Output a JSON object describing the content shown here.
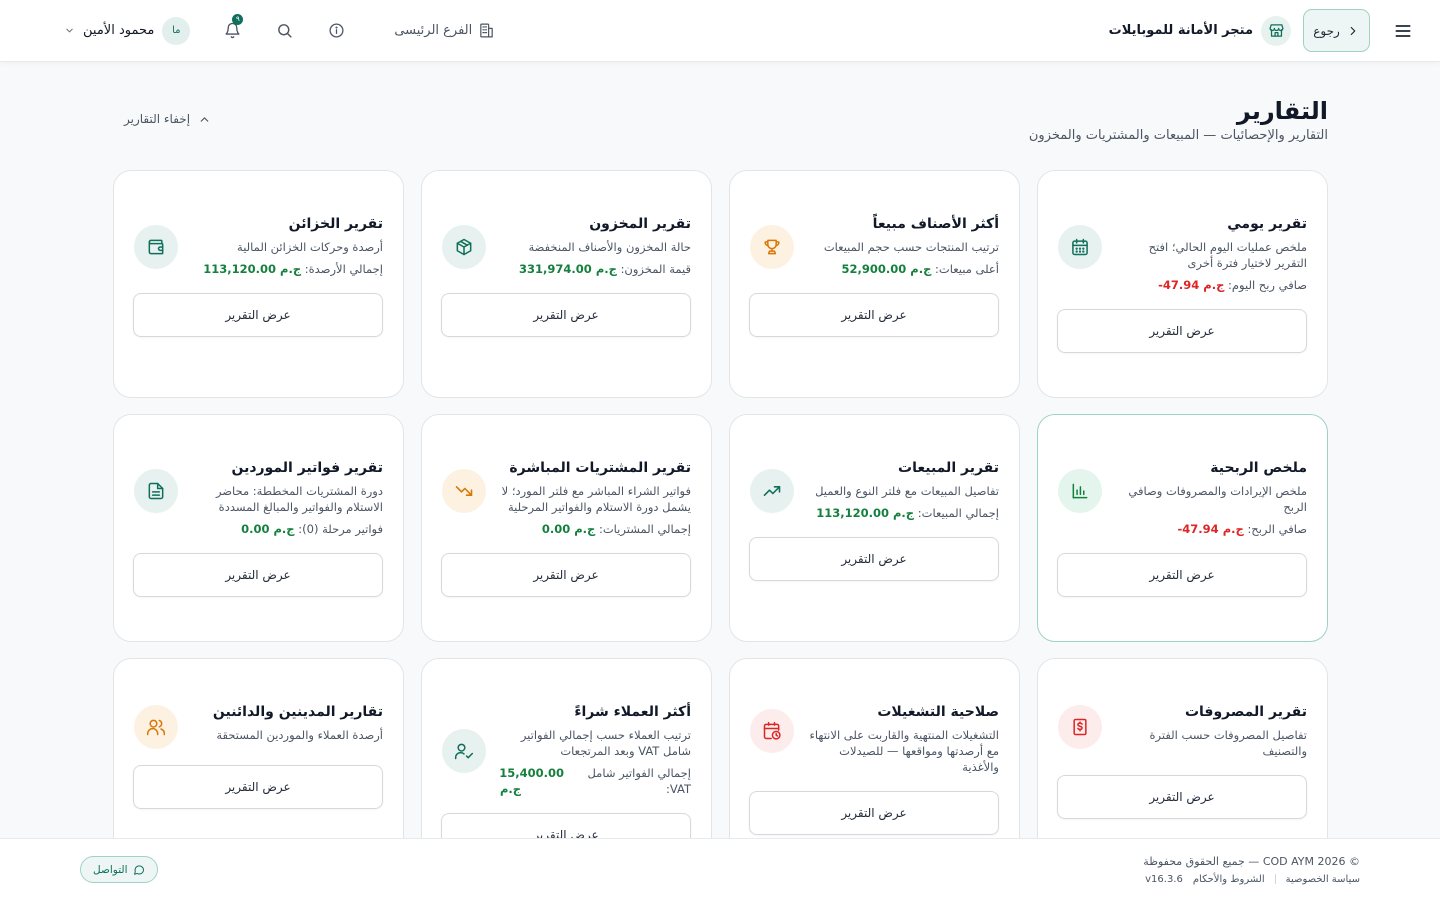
{
  "header": {
    "store_name": "متجر الأمانة للموبايلات",
    "back_label": "رجوع",
    "user_initials": "ما",
    "user_name": "محمود الأمين",
    "notification_count": "٩",
    "branch": "الفرع الرئيسى"
  },
  "page": {
    "title": "التقارير",
    "subtitle": "التقارير والإحصائيات — المبيعات والمشتريات والمخزون",
    "hide_reports": "إخفاء التقارير"
  },
  "view_report_label": "عرض التقرير",
  "cards": [
    {
      "title": "تقرير يومي",
      "desc": "ملخص عمليات اليوم الحالي؛ افتح التقرير لاختيار فترة أخرى",
      "metric_label": "صافي ربح اليوم:",
      "metric_value": "ج.م 47.94-",
      "icon": "calendar-icon"
    },
    {
      "title": "أكثر الأصناف مبيعاً",
      "desc": "ترتيب المنتجات حسب حجم المبيعات",
      "metric_label": "أعلى مبيعات:",
      "metric_value": "ج.م 52,900.00",
      "icon": "trophy-icon"
    },
    {
      "title": "تقرير المخزون",
      "desc": "حالة المخزون والأصناف المنخفضة",
      "metric_label": "قيمة المخزون:",
      "metric_value": "ج.م 331,974.00",
      "icon": "package-icon"
    },
    {
      "title": "تقرير الخزائن",
      "desc": "أرصدة وحركات الخزائن المالية",
      "metric_label": "إجمالي الأرصدة:",
      "metric_value": "ج.م 113,120.00",
      "icon": "wallet-icon"
    },
    {
      "title": "ملخص الربحية",
      "desc": "ملخص الإيرادات والمصروفات وصافي الربح",
      "metric_label": "صافي الربح:",
      "metric_value": "ج.م 47.94-",
      "icon": "bar-chart-icon"
    },
    {
      "title": "تقرير المبيعات",
      "desc": "تفاصيل المبيعات مع فلتر النوع والعميل",
      "metric_label": "إجمالي المبيعات:",
      "metric_value": "ج.م 113,120.00",
      "icon": "trending-up-icon"
    },
    {
      "title": "تقرير المشتريات المباشرة",
      "desc": "فواتير الشراء المباشر مع فلتر المورد؛ لا يشمل دورة الاستلام والفواتير المرحلية",
      "metric_label": "إجمالي المشتريات:",
      "metric_value": "ج.م 0.00",
      "icon": "trending-down-icon"
    },
    {
      "title": "تقرير فواتير الموردين",
      "desc": "دورة المشتريات المخططة: محاضر الاستلام والفواتير والمبالغ المسددة",
      "metric_label": "فواتير مرحلة (0):",
      "metric_value": "ج.م 0.00",
      "icon": "file-text-icon"
    },
    {
      "title": "تقرير المصروفات",
      "desc": "تفاصيل المصروفات حسب الفترة والتصنيف",
      "icon": "receipt-icon"
    },
    {
      "title": "صلاحية التشغيلات",
      "desc": "التشغيلات المنتهية والقاربت على الانتهاء مع أرصدتها ومواقعها — للصيدلات والأغذية",
      "icon": "calendar-clock-icon"
    },
    {
      "title": "أكثر العملاء شراءً",
      "desc": "ترتيب العملاء حسب إجمالي الفواتير شامل VAT وبعد المرتجعات",
      "metric_label": "إجمالي الفواتير شامل VAT:",
      "metric_value": "15,400.00 ج.م",
      "icon": "user-check-icon"
    },
    {
      "title": "تقارير المدينين والدائنين",
      "desc": "أرصدة العملاء والموردين المستحقة",
      "icon": "users-icon"
    }
  ],
  "footer": {
    "copyright": "© COD AYM 2026 — جميع الحقوق محفوظة",
    "privacy": "سياسة الخصوصية",
    "terms": "الشروط والأحكام",
    "version": "v16.3.6",
    "contact": "التواصل"
  },
  "colors": {
    "accent": "#0f6f5c",
    "positive": "#15803d",
    "negative": "#dc2626",
    "background": "#f8f9fa"
  }
}
